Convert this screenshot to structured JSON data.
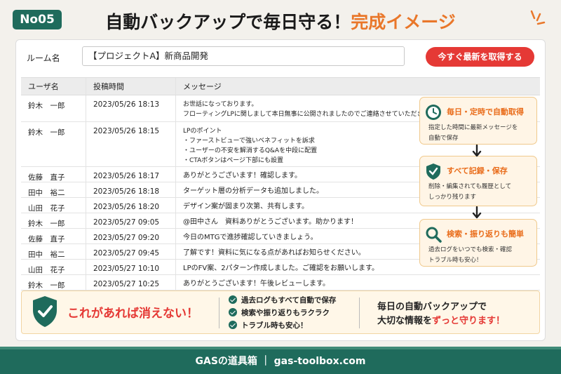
{
  "header": {
    "badge": "No05",
    "title_main": "自動バックアップで毎日守る！",
    "title_accent": "完成イメージ"
  },
  "room": {
    "label": "ルーム名",
    "value": "【プロジェクトA】新商品開発",
    "fetch_button": "今すぐ最新を取得する"
  },
  "table": {
    "columns": [
      "ユーザ名",
      "投稿時間",
      "メッセージ"
    ],
    "rows": [
      {
        "user": "鈴木　一郎",
        "time": "2023/05/26 18:13",
        "lines": [
          "お世話になっております。",
          "フローティングLPに関しまして本日無事に公開されましたのでご連絡させていただきます"
        ]
      },
      {
        "user": "鈴木　一郎",
        "time": "2023/05/26 18:15",
        "lines": [
          "LPのポイント",
          "・ファーストビューで強いベネフィットを訴求",
          "・ユーザーの不安を解消するQ&Aを中段に配置",
          "・CTAボタンはページ下部にも設置"
        ]
      },
      {
        "user": "佐藤　直子",
        "time": "2023/05/26 18:17",
        "lines": [
          "ありがとうございます！確認します。"
        ]
      },
      {
        "user": "田中　裕二",
        "time": "2023/05/26 18:18",
        "lines": [
          "ターゲット層の分析データも追加しました。"
        ]
      },
      {
        "user": "山田　花子",
        "time": "2023/05/26 18:20",
        "lines": [
          "デザイン案が固まり次第、共有します。"
        ]
      },
      {
        "user": "鈴木　一郎",
        "time": "2023/05/27 09:05",
        "lines": [
          "@田中さん　資料ありがとうございます。助かります！"
        ]
      },
      {
        "user": "佐藤　直子",
        "time": "2023/05/27 09:20",
        "lines": [
          "今日のMTGで進捗確認していきましょう。"
        ]
      },
      {
        "user": "田中　裕二",
        "time": "2023/05/27 09:45",
        "lines": [
          "了解です！資料に気になる点があればお知らせください。"
        ]
      },
      {
        "user": "山田　花子",
        "time": "2023/05/27 10:10",
        "lines": [
          "LPのFV案、2パターン作成しました。ご確認をお願いします。"
        ]
      },
      {
        "user": "鈴木　一郎",
        "time": "2023/05/27 10:25",
        "lines": [
          "ありがとうございます！午後レビューします。"
        ]
      }
    ]
  },
  "features": [
    {
      "title": "毎日・定時で自動取得",
      "lines": [
        "指定した時間に最新メッセージを",
        "自動で保存"
      ],
      "icon": "clock-icon"
    },
    {
      "title": "すべて記録・保存",
      "lines": [
        "削除・編集されても履歴として",
        "しっかり残ります"
      ],
      "icon": "shield-check-icon"
    },
    {
      "title": "検索・振り返りも簡単",
      "lines": [
        "過去ログをいつでも検索・確認",
        "トラブル時も安心！"
      ],
      "icon": "magnifier-icon"
    }
  ],
  "promo": {
    "headline": "これがあれば消えない！",
    "checks": [
      "過去ログもすべて自動で保存",
      "検索や振り返りもラクラク",
      "トラブル時も安心！"
    ],
    "right_line1": "毎日の自動バックアップで",
    "right_line2_pre": "大切な情報を",
    "right_line2_hl": "ずっと守ります！"
  },
  "footer": {
    "text": "GASの道具箱 ｜ gas-toolbox.com"
  },
  "colors": {
    "brand_green": "#1f6b5c",
    "accent_orange": "#e9772a",
    "alert_red": "#e53935"
  }
}
